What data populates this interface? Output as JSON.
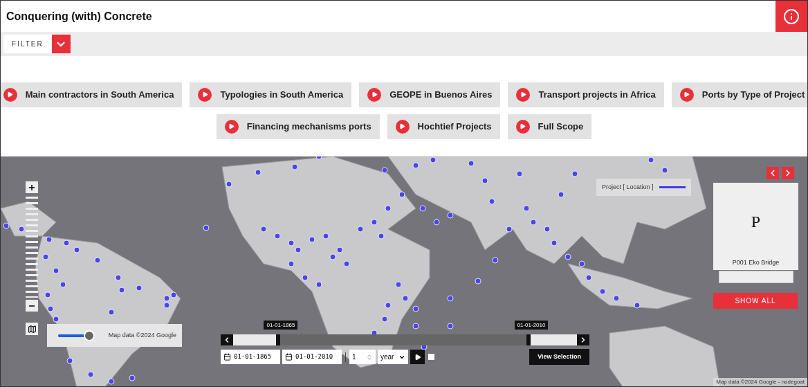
{
  "header": {
    "title": "Conquering (with) Concrete"
  },
  "filter": {
    "label": "FILTER",
    "expanded": false
  },
  "stories": [
    [
      {
        "label": "Main contractors in South America"
      },
      {
        "label": "Typologies in South America"
      },
      {
        "label": "GEOPE in Buenos Aires"
      },
      {
        "label": "Transport projects in Africa"
      },
      {
        "label": "Ports by Type of Project"
      }
    ],
    [
      {
        "label": "Financing mechanisms ports"
      },
      {
        "label": "Hochtief Projects"
      },
      {
        "label": "Full Scope"
      }
    ]
  ],
  "map": {
    "legend": "Project [ Location ]",
    "opacity": {
      "level": 0.85,
      "attribution": "Map data ©2024 Google"
    },
    "footer": "Map data ©2024 Google - nodegoat"
  },
  "card": {
    "letter": "P",
    "name": "P001 Eko Bridge",
    "show_all": "SHOW ALL"
  },
  "timeline": {
    "start_handle": {
      "label": "01-01-1865",
      "level": 0.13
    },
    "end_handle": {
      "label": "01-01-2010",
      "level": 0.86
    },
    "start_date": "01-01-1865",
    "end_date": "01-01-2010",
    "step": "1",
    "unit": "year",
    "loop": false,
    "view": "View Selection"
  }
}
